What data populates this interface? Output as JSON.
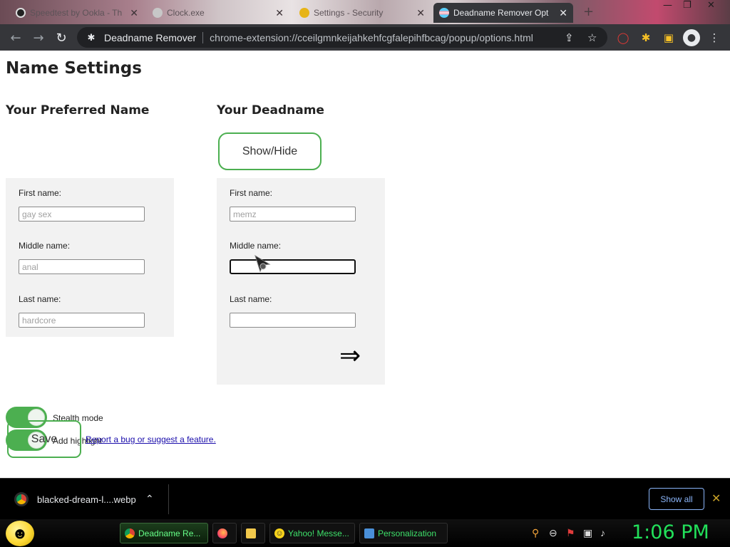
{
  "browser": {
    "tabs": [
      {
        "title": "Speedtest by Ookla - Th",
        "active": false
      },
      {
        "title": "Clock.exe",
        "active": false
      },
      {
        "title": "Settings - Security",
        "active": false
      },
      {
        "title": "Deadname Remover Opt",
        "active": true
      }
    ],
    "site_name": "Deadname Remover",
    "url": "chrome-extension://cceilgmnkeijahkehfcgfalepihfbcag/popup/options.html"
  },
  "page": {
    "title": "Name Settings",
    "preferred": {
      "heading": "Your Preferred Name",
      "first_label": "First name:",
      "first_placeholder": "gay sex",
      "middle_label": "Middle name:",
      "middle_placeholder": "anal",
      "last_label": "Last name:",
      "last_placeholder": "hardcore"
    },
    "deadname": {
      "heading": "Your Deadname",
      "show_hide_label": "Show/Hide",
      "first_label": "First name:",
      "first_placeholder": "memz",
      "middle_label": "Middle name:",
      "middle_value": "",
      "last_label": "Last name:",
      "last_value": "",
      "arrow_glyph": "⇒"
    },
    "stealth_label": "Stealth mode",
    "highlight_label": "Add highlight",
    "save_label": "Save",
    "report_link": "Report a bug or suggest a feature."
  },
  "downloads": {
    "file_name": "blacked-dream-l....webp",
    "show_all_label": "Show all"
  },
  "taskbar": {
    "items": [
      {
        "label": "Deadname Re...",
        "active": true
      },
      {
        "label": "",
        "active": false
      },
      {
        "label": "",
        "active": false
      },
      {
        "label": "Yahoo! Messe...",
        "active": false
      },
      {
        "label": "Personalization",
        "active": false
      }
    ],
    "clock": "1:06 PM"
  },
  "colors": {
    "accent_green": "#4caf50",
    "toolbar": "#35363a",
    "clock_green": "#22e05a"
  }
}
